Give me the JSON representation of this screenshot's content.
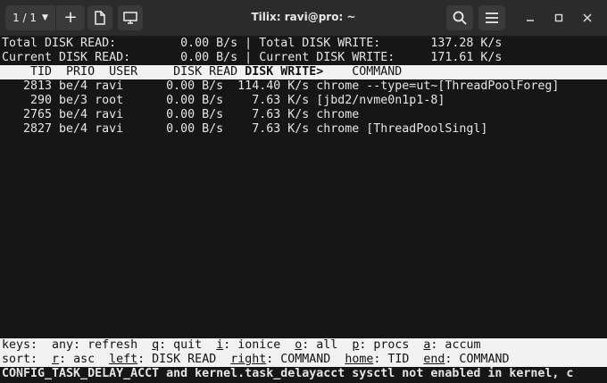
{
  "titlebar": {
    "session_label": "1 / 1",
    "title": "Tilix: ravi@pro: ~"
  },
  "summary": {
    "total_read": "Total DISK READ:         0.00 B/s | Total DISK WRITE:       137.28 K/s",
    "current_read": "Current DISK READ:       0.00 B/s | Current DISK WRITE:     171.61 K/s"
  },
  "header": {
    "pre": "    TID  PRIO  USER     DISK READ ",
    "sorted": "DISK WRITE>",
    "post": "    COMMAND"
  },
  "rows": [
    "   2813 be/4 ravi      0.00 B/s  114.40 K/s chrome --type=ut~[ThreadPoolForeg]",
    "    290 be/3 root      0.00 B/s    7.63 K/s [jbd2/nvme0n1p1-8]",
    "   2765 be/4 ravi      0.00 B/s    7.63 K/s chrome",
    "   2827 be/4 ravi      0.00 B/s    7.63 K/s chrome [ThreadPoolSingl]"
  ],
  "keys": {
    "t0": "keys:  any: refresh  ",
    "k1": "q",
    "t1": ": quit  ",
    "k2": "i",
    "t2": ": ionice  ",
    "k3": "o",
    "t3": ": all  ",
    "k4": "p",
    "t4": ": procs  ",
    "k5": "a",
    "t5": ": accum"
  },
  "sort": {
    "t0": "sort:  ",
    "k1": "r",
    "t1": ": asc  ",
    "k2": "left",
    "t2": ": DISK READ  ",
    "k3": "right",
    "t3": ": COMMAND  ",
    "k4": "home",
    "t4": ": TID  ",
    "k5": "end",
    "t5": ": COMMAND"
  },
  "status": "CONFIG_TASK_DELAY_ACCT and kernel.task_delayacct sysctl not enabled in kernel, c"
}
